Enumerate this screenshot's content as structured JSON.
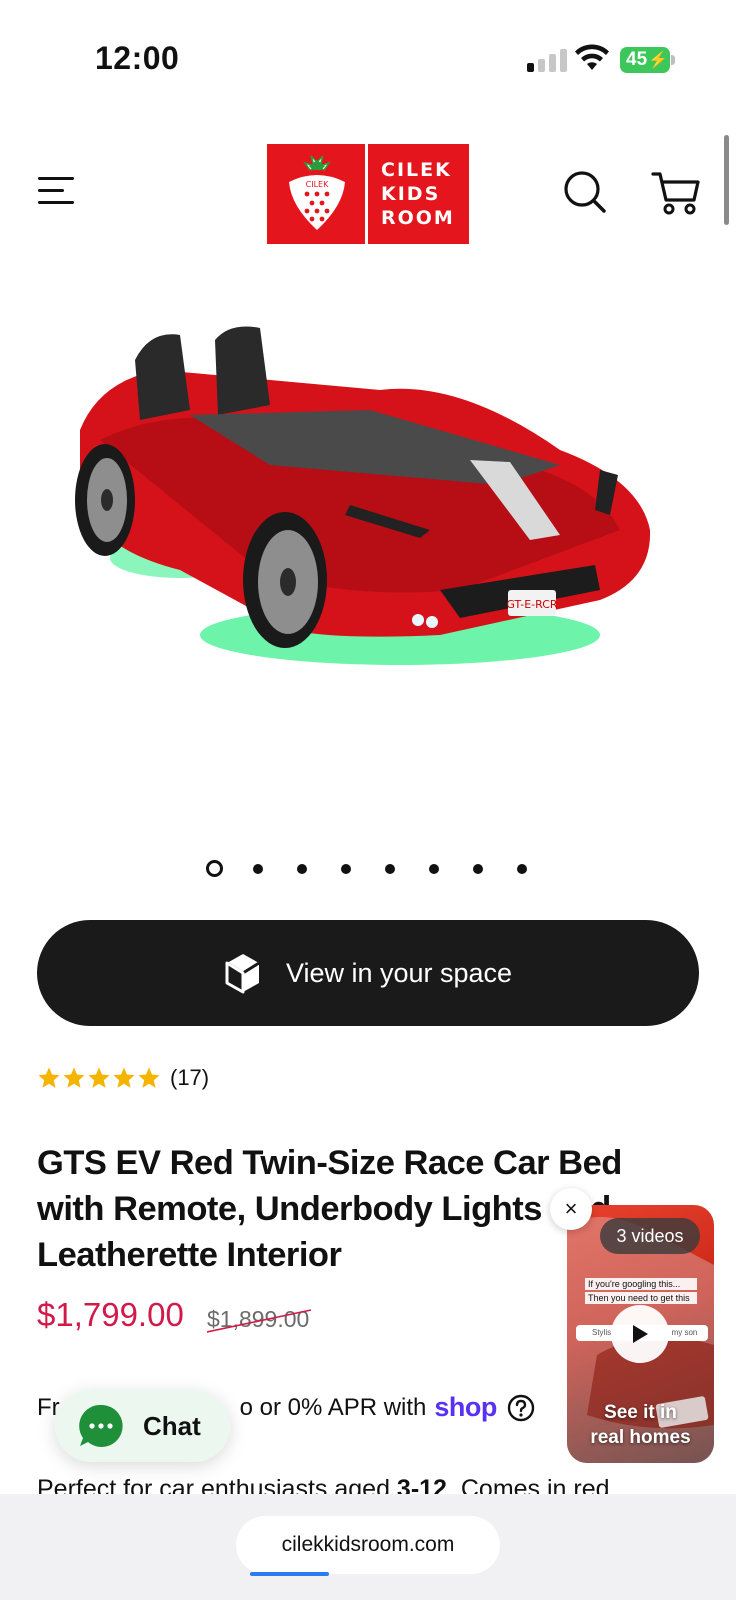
{
  "status_bar": {
    "time": "12:00",
    "battery_level": "45",
    "signal_bars_active": 1,
    "signal_bars_total": 4,
    "icons": [
      "cellular-signal-icon",
      "wifi-icon",
      "battery-charging-icon"
    ]
  },
  "header": {
    "logo_lines": [
      "CILEK",
      "KIDS",
      "ROOM"
    ],
    "logo_mark_text": "CILEK",
    "icons": [
      "hamburger-menu-icon",
      "search-icon",
      "cart-icon"
    ]
  },
  "gallery": {
    "total_images": 8,
    "active_index": 0
  },
  "view_in_space": {
    "label": "View in your space",
    "icon": "ar-cube-icon"
  },
  "rating": {
    "stars": 5,
    "review_count": "(17)",
    "color": "#f5b400"
  },
  "product": {
    "title": "GTS EV Red Twin-Size Race Car Bed with Remote, Underbody Lights and Leatherette Interior",
    "price": "$1,799.00",
    "compare_price": "$1,899.00",
    "price_color": "#d11a4a"
  },
  "shop_pay": {
    "text_before": "Fr",
    "text_after": "o or 0% APR with",
    "brand": "shop",
    "brand_color": "#5a31f4"
  },
  "description": {
    "prefix": "Perfect for car enthusiasts aged ",
    "age_range": "3-12",
    "suffix": ". Comes in red"
  },
  "chat": {
    "label": "Chat",
    "icon": "chat-bubble-icon",
    "color": "#1f8f3a"
  },
  "video_widget": {
    "count_label": "3 videos",
    "caption_line1": "If you're googling this...",
    "caption_line2": "Then you need to get this",
    "search_left": "Stylis",
    "search_right": "my son",
    "cta_line1": "See it in",
    "cta_line2": "real homes",
    "close_label": "×"
  },
  "browser": {
    "url": "cilekkidsroom.com",
    "load_progress": 0.3
  }
}
